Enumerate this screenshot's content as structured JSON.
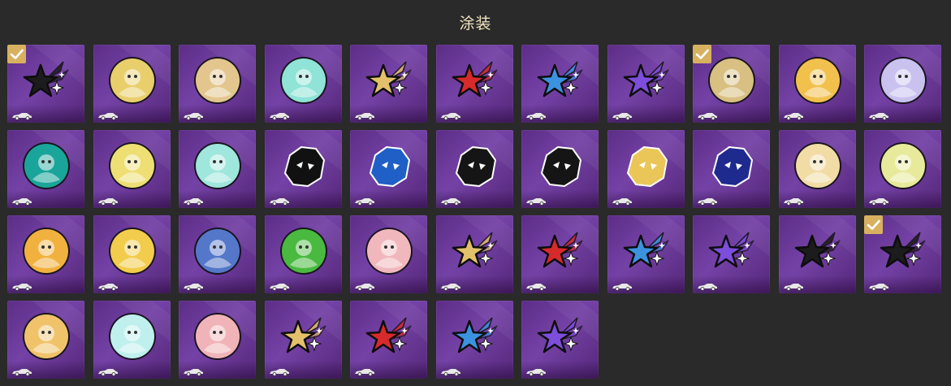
{
  "header": {
    "title": "涂装"
  },
  "colors": {
    "tile_bg": "#6a389a",
    "badge": "#d8b160",
    "title": "#f3e6c2",
    "gold": "#e3c06a",
    "red": "#d72a2a",
    "blue": "#3b93e0",
    "purple": "#7d4ddc",
    "black": "#1c1c1c"
  },
  "items": [
    {
      "icon": "black-star-spray-icon",
      "kind": "star",
      "color": "#1c1c1c",
      "equipped": true
    },
    {
      "icon": "character-portrait-icon",
      "kind": "circle",
      "color": "#e9cf6c",
      "equipped": false
    },
    {
      "icon": "character-portrait-icon",
      "kind": "circle",
      "color": "#e2c68e",
      "equipped": false
    },
    {
      "icon": "abstract-ribbon-icon",
      "kind": "circle",
      "color": "#8fe3d7",
      "equipped": false
    },
    {
      "icon": "gold-star-spray-icon",
      "kind": "star",
      "color": "#e3c06a",
      "equipped": false
    },
    {
      "icon": "red-star-spray-icon",
      "kind": "star",
      "color": "#d72a2a",
      "equipped": false
    },
    {
      "icon": "blue-star-spray-icon",
      "kind": "star",
      "color": "#3b93e0",
      "equipped": false
    },
    {
      "icon": "purple-star-spray-icon",
      "kind": "star",
      "color": "#7d4ddc",
      "equipped": false
    },
    {
      "icon": "emblem-icon",
      "kind": "circle",
      "color": "#d8bf82",
      "equipped": true
    },
    {
      "icon": "cartoon-circle-icon",
      "kind": "circle",
      "color": "#f2c04d",
      "equipped": false
    },
    {
      "icon": "tricolor-swirl-icon",
      "kind": "circle",
      "color": "#c9c2ef",
      "equipped": false
    },
    {
      "icon": "teal-logo-icon",
      "kind": "circle",
      "color": "#1aa59a",
      "equipped": false
    },
    {
      "icon": "character-portrait-icon",
      "kind": "circle",
      "color": "#eedf74",
      "equipped": false
    },
    {
      "icon": "cyan-blob-icon",
      "kind": "circle",
      "color": "#9fe6dc",
      "equipped": false
    },
    {
      "icon": "shadow-hedgehog-icon",
      "kind": "shape",
      "color": "#111111",
      "equipped": false
    },
    {
      "icon": "blue-hedgehog-icon",
      "kind": "shape",
      "color": "#1f5fc6",
      "equipped": false
    },
    {
      "icon": "black-cat-mask-icon",
      "kind": "shape",
      "color": "#151515",
      "equipped": false
    },
    {
      "icon": "masked-hero-icon",
      "kind": "shape",
      "color": "#151515",
      "equipped": false
    },
    {
      "icon": "blonde-hero-icon",
      "kind": "shape",
      "color": "#e9c657",
      "equipped": false
    },
    {
      "icon": "blue-hair-hero-icon",
      "kind": "shape",
      "color": "#1f2a8e",
      "equipped": false
    },
    {
      "icon": "cream-character-icon",
      "kind": "circle",
      "color": "#f2dca6",
      "equipped": false
    },
    {
      "icon": "sleepy-creature-icon",
      "kind": "circle",
      "color": "#e7ea9a",
      "equipped": false
    },
    {
      "icon": "bird-circle-icon",
      "kind": "circle",
      "color": "#f1b13f",
      "equipped": false
    },
    {
      "icon": "cow-circle-icon",
      "kind": "circle",
      "color": "#f2cc4c",
      "equipped": false
    },
    {
      "icon": "pink-character-icon",
      "kind": "circle",
      "color": "#5577c9",
      "equipped": false
    },
    {
      "icon": "green-monster-icon",
      "kind": "circle",
      "color": "#49b93f",
      "equipped": false
    },
    {
      "icon": "pastel-creature-icon",
      "kind": "circle",
      "color": "#f0b8bd",
      "equipped": false
    },
    {
      "icon": "gold-star-spray-icon",
      "kind": "star",
      "color": "#e3c06a",
      "equipped": false
    },
    {
      "icon": "red-star-spray-icon",
      "kind": "star",
      "color": "#d72a2a",
      "equipped": false
    },
    {
      "icon": "blue-star-spray-icon",
      "kind": "star",
      "color": "#3b93e0",
      "equipped": false
    },
    {
      "icon": "purple-star-spray-icon",
      "kind": "star",
      "color": "#7d4ddc",
      "equipped": false
    },
    {
      "icon": "black-star-spray-icon",
      "kind": "star",
      "color": "#1c1c1c",
      "equipped": false
    },
    {
      "icon": "black-star-spray-icon",
      "kind": "star",
      "color": "#1c1c1c",
      "equipped": true
    },
    {
      "icon": "white-character-icon",
      "kind": "circle",
      "color": "#f0c36a",
      "equipped": false
    },
    {
      "icon": "pink-cat-icon",
      "kind": "circle",
      "color": "#bff0ee",
      "equipped": false
    },
    {
      "icon": "character-portrait-icon",
      "kind": "circle",
      "color": "#f0b4b8",
      "equipped": false
    },
    {
      "icon": "gold-star-spray-icon",
      "kind": "star",
      "color": "#e3c06a",
      "equipped": false
    },
    {
      "icon": "red-star-spray-icon",
      "kind": "star",
      "color": "#d72a2a",
      "equipped": false
    },
    {
      "icon": "blue-star-spray-icon",
      "kind": "star",
      "color": "#3b93e0",
      "equipped": false
    },
    {
      "icon": "purple-star-spray-icon",
      "kind": "star",
      "color": "#7d4ddc",
      "equipped": false
    }
  ]
}
